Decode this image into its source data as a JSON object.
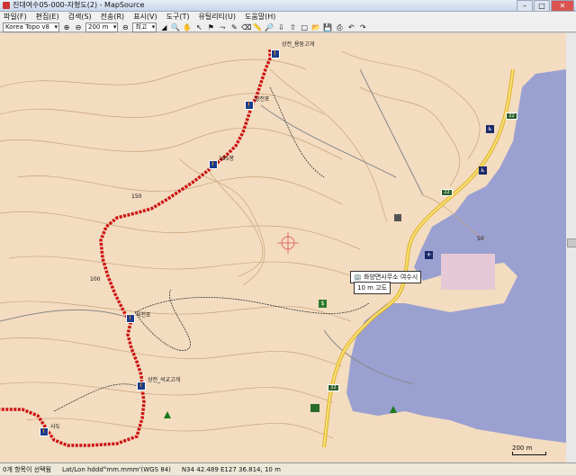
{
  "window": {
    "title": "진대여수05-000-자형도(2) - MapSource",
    "minimize": "–",
    "maximize": "□",
    "close": "✕"
  },
  "menu": [
    "파일(F)",
    "편집(E)",
    "검색(S)",
    "전송(R)",
    "표시(V)",
    "도구(T)",
    "유틸리티(U)",
    "도움말(H)"
  ],
  "toolbar": {
    "map_product": "Korea Topo v8",
    "zoom": "200 m",
    "detail": "최고"
  },
  "map": {
    "road_sign": "22",
    "labels": {
      "pass1": "상전_용둥고개",
      "peak1": "당전포",
      "elev": "195봉",
      "junction": "육전포",
      "pass2": "상전_석교고개",
      "bottom": "사도",
      "contour150": "150",
      "contour100": "100",
      "contour50": "50"
    },
    "poi": {
      "title": "화양면사무소 여수시",
      "elevation": "10 m 고도"
    },
    "scale": "200 m"
  },
  "status": {
    "selection": "0개 항목이 선택됨",
    "format": "Lat/Lon hddd°mm.mmm'(WGS 84)",
    "coords": "N34 42.489 E127 36.814, 10 m"
  },
  "colors": {
    "route": "#cc1111",
    "sea": "#9aa0d0",
    "terrain": "#f3dcc0",
    "road": "#f0d040"
  }
}
